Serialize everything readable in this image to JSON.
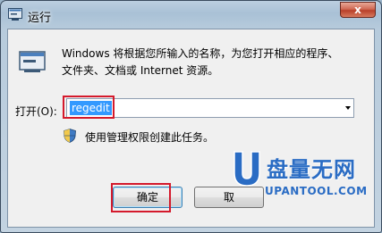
{
  "window": {
    "title": "运行",
    "close_glyph": "x"
  },
  "description": {
    "line1": "Windows 将根据您所输入的名称，为您打开相应的程序、",
    "line2": "文件夹、文档或 Internet 资源。"
  },
  "open_field": {
    "label": "打开(O):",
    "value": "regedit"
  },
  "admin_note": "使用管理权限创建此任务。",
  "buttons": {
    "ok": "确定",
    "cancel": "取"
  },
  "watermark": {
    "name": "盘量无网",
    "url": "UPANTOOL.COM"
  },
  "colors": {
    "highlight": "#d41a2c",
    "selection": "#3399ff",
    "watermark": "#2a6cc4"
  },
  "icons": {
    "title": "run-window-icon",
    "main": "run-program-icon",
    "shield": "uac-shield-icon",
    "close": "close-icon",
    "dropdown": "chevron-down-icon"
  }
}
